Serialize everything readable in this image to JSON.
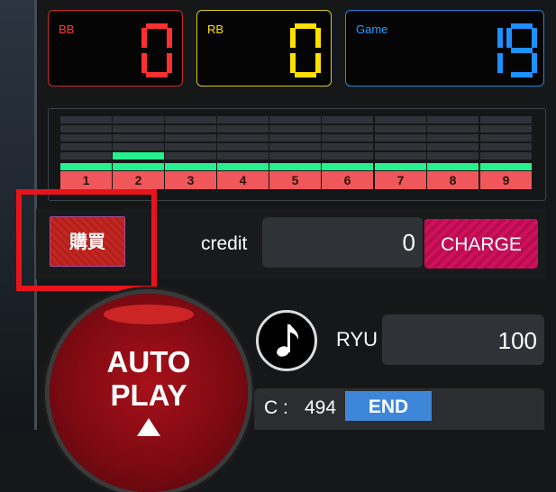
{
  "counters": {
    "bb": {
      "label": "BB",
      "value": "0",
      "color": "#ff3030"
    },
    "rb": {
      "label": "RB",
      "value": "0",
      "color": "#ffe000"
    },
    "game": {
      "label": "Game",
      "value": "19",
      "color": "#1e90ff"
    }
  },
  "reels": [
    {
      "number": "1",
      "level": 1
    },
    {
      "number": "2",
      "level": 2
    },
    {
      "number": "3",
      "level": 1
    },
    {
      "number": "4",
      "level": 1
    },
    {
      "number": "5",
      "level": 1
    },
    {
      "number": "6",
      "level": 1
    },
    {
      "number": "7",
      "level": 1
    },
    {
      "number": "8",
      "level": 1
    },
    {
      "number": "9",
      "level": 1
    }
  ],
  "buy_button": {
    "label": "購買"
  },
  "credit": {
    "label": "credit",
    "value": "0"
  },
  "charge_button": {
    "label": "CHARGE"
  },
  "autoplay": {
    "line1": "AUTO",
    "line2": "PLAY"
  },
  "music_icon": "music-note-icon",
  "ryu": {
    "label": "RYU",
    "value": "100"
  },
  "c_counter": {
    "label": "C :",
    "value": "494"
  },
  "end_button": {
    "label": "END"
  },
  "colors": {
    "highlight_box": "#e8141b",
    "reel_active": "#27f08e",
    "reel_number_bg": "#f0575a",
    "charge": "#d0105d",
    "end": "#3d86d8"
  }
}
